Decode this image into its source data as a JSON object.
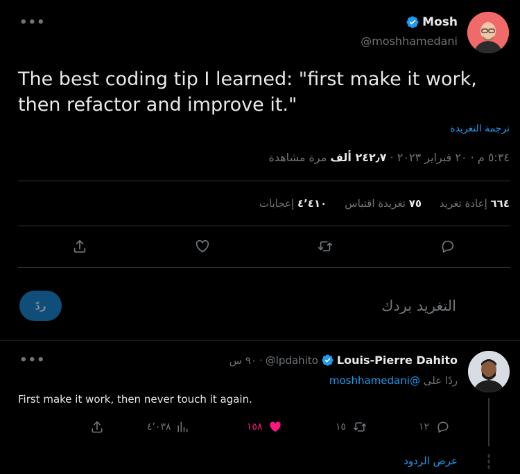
{
  "tweet": {
    "author_name": "Mosh",
    "author_handle": "@moshhamedani",
    "text": "The best coding tip I learned: \"first make it work, then refactor and improve it.\"",
    "translate_label": "ترجمة التغريدة",
    "time": "٥:٣٤ م",
    "date": "٢٠ فبراير ٢٠٢٣",
    "views_count": "٢٤٢٫٧ ألف",
    "views_label": "مرة مشاهدة",
    "retweets_count": "٦٦٤",
    "retweets_label": "إعادة تغريد",
    "quotes_count": "٧٥",
    "quotes_label": "تغريدة اقتباس",
    "likes_count": "٤٬٤١٠",
    "likes_label": "إعجابات"
  },
  "compose": {
    "placeholder": "التغريد بردك",
    "reply_button": "ردّ"
  },
  "reply": {
    "author_name": "Louis-Pierre Dahito",
    "author_handle": "@lpdahito",
    "time": "٩٠ س",
    "replying_to_label": "ردًا على",
    "replying_to_handle": "@moshhamedani",
    "text": "First make it work, then never touch it again.",
    "reply_count": "١٢",
    "retweet_count": "١٥",
    "like_count": "١٥٨",
    "views_count": "٤٬٠٣٨",
    "show_replies": "عرض الردود"
  },
  "colors": {
    "accent": "#1d9bf0",
    "like": "#f91880",
    "muted": "#71767b",
    "background": "#000000"
  }
}
